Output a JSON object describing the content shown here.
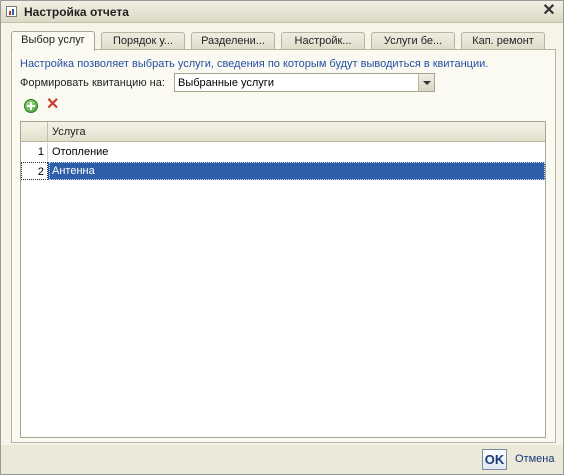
{
  "window": {
    "title": "Настройка отчета",
    "close_icon": "close-icon"
  },
  "tabs": [
    {
      "label": "Выбор услуг",
      "active": true
    },
    {
      "label": "Порядок у..."
    },
    {
      "label": "Разделени..."
    },
    {
      "label": "Настройк..."
    },
    {
      "label": "Услуги бе..."
    },
    {
      "label": "Кап. ремонт"
    }
  ],
  "panel": {
    "hint": "Настройка позволяет выбрать услуги, сведения по которым будут выводиться в квитанции.",
    "form_label": "Формировать квитанцию на:",
    "form_value": "Выбранные услуги"
  },
  "toolbar": {
    "add_icon": "add-icon",
    "delete_icon": "delete-icon"
  },
  "table": {
    "column_header": "Услуга",
    "rows": [
      {
        "num": "1",
        "label": "Отопление",
        "selected": false
      },
      {
        "num": "2",
        "label": "Антенна",
        "selected": true
      }
    ]
  },
  "footer": {
    "ok_label": "OK",
    "cancel_label": "Отмена"
  }
}
